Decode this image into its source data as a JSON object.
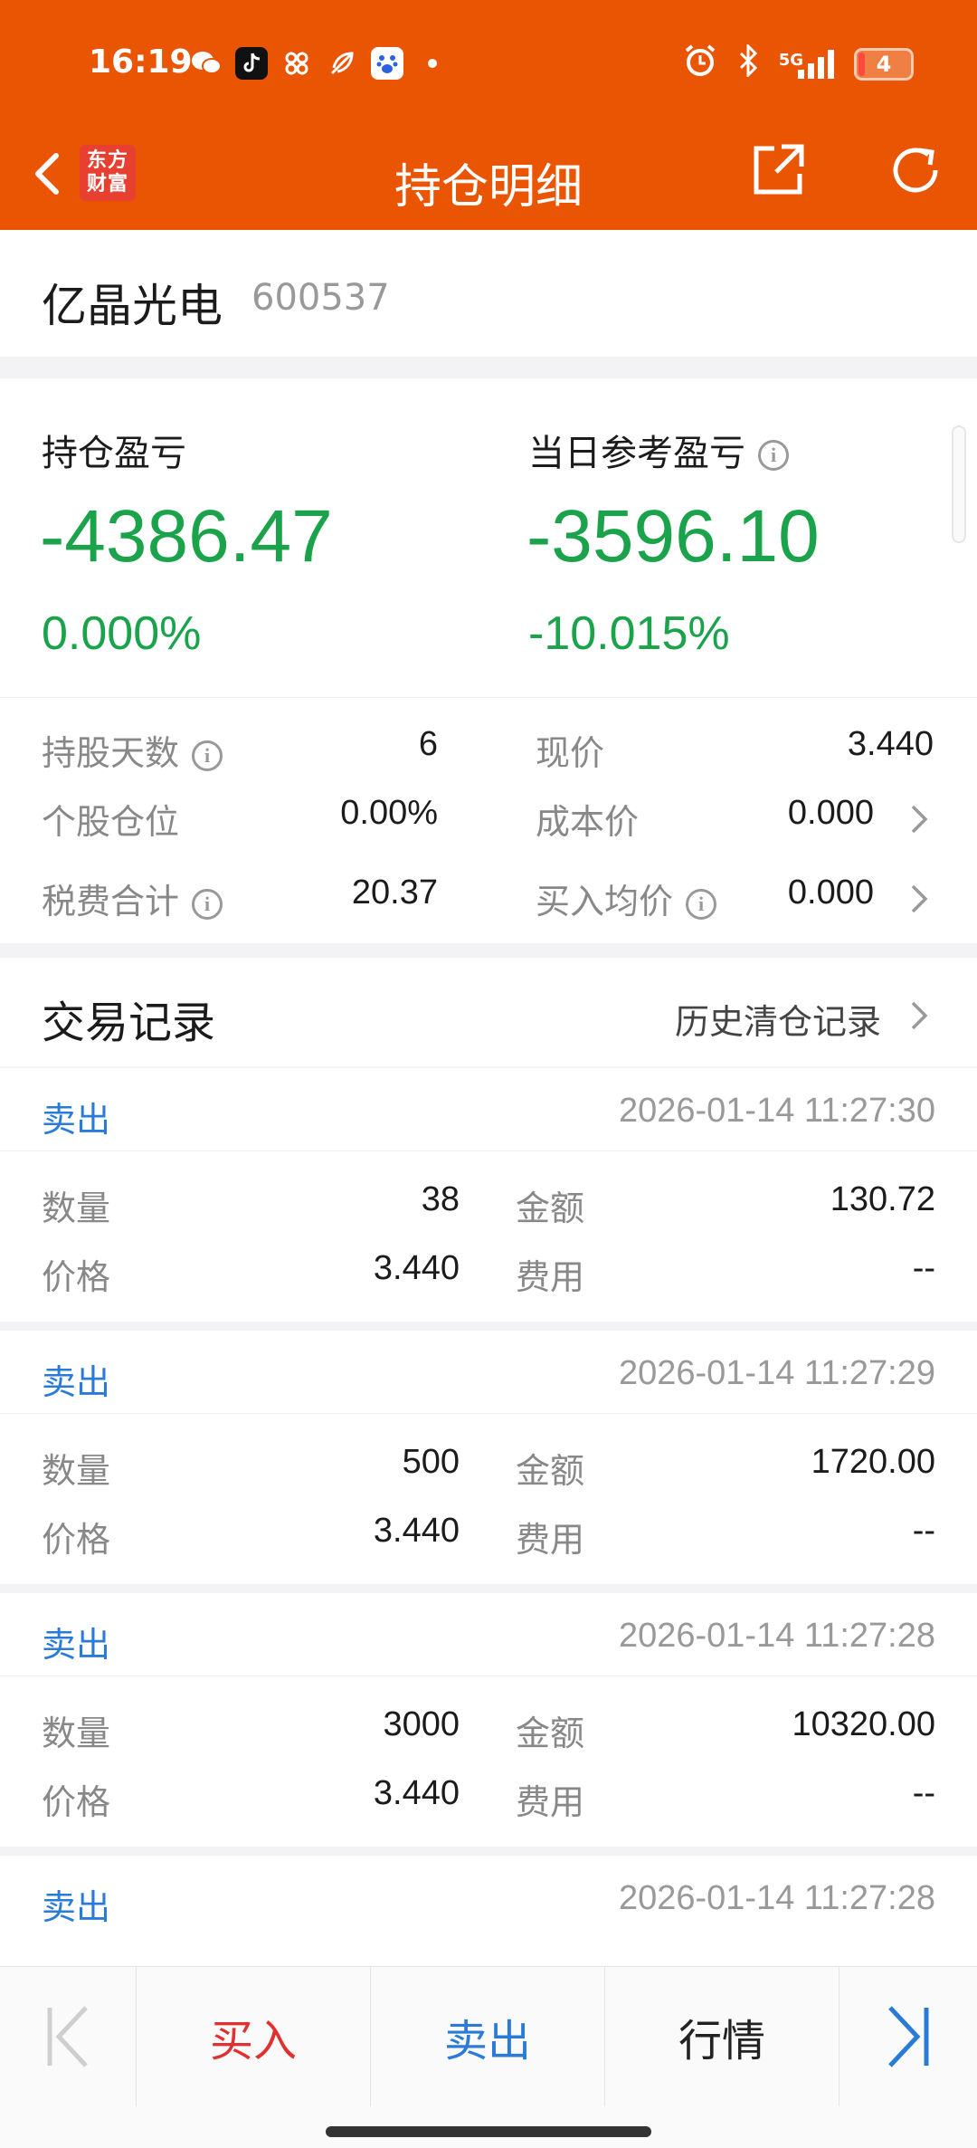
{
  "status_bar": {
    "time": "16:19",
    "network": "5G",
    "battery_level": "4",
    "battery_fraction": 0.12
  },
  "nav": {
    "logo_text_line1": "东方",
    "logo_text_line2": "财富",
    "title": "持仓明细",
    "icons": [
      "back-icon",
      "share-icon",
      "refresh-icon"
    ]
  },
  "stock": {
    "name": "亿晶光电",
    "code": "600537"
  },
  "pnl": {
    "position_label": "持仓盈亏",
    "position_value": "-4386.47",
    "position_pct": "0.000%",
    "daily_label": "当日参考盈亏",
    "daily_value": "-3596.10",
    "daily_pct": "-10.015%",
    "color_loss": "#1aa34a"
  },
  "details": [
    {
      "k1": "持股天数",
      "v1": "6",
      "k2": "现价",
      "v2": "3.440"
    },
    {
      "k1": "个股仓位",
      "v1": "0.00%",
      "k2": "成本价",
      "v2": "0.000"
    },
    {
      "k1": "税费合计",
      "v1": "20.37",
      "k2": "买入均价",
      "v2": "0.000"
    }
  ],
  "transactions": {
    "title": "交易记录",
    "history_link": "历史清仓记录",
    "labels": {
      "qty": "数量",
      "amount": "金额",
      "price": "价格",
      "fee": "费用"
    },
    "records": [
      {
        "type": "卖出",
        "datetime": "2026-01-14 11:27:30",
        "qty": "38",
        "amount": "130.72",
        "price": "3.440",
        "fee": "--"
      },
      {
        "type": "卖出",
        "datetime": "2026-01-14 11:27:29",
        "qty": "500",
        "amount": "1720.00",
        "price": "3.440",
        "fee": "--"
      },
      {
        "type": "卖出",
        "datetime": "2026-01-14 11:27:28",
        "qty": "3000",
        "amount": "10320.00",
        "price": "3.440",
        "fee": "--"
      },
      {
        "type": "卖出",
        "datetime": "2026-01-14 11:27:28"
      }
    ]
  },
  "bottom_bar": {
    "buy": "买入",
    "sell": "卖出",
    "quote": "行情",
    "colors": {
      "buy": "#e03030",
      "sell": "#2a7bd8",
      "quote": "#222222"
    }
  }
}
